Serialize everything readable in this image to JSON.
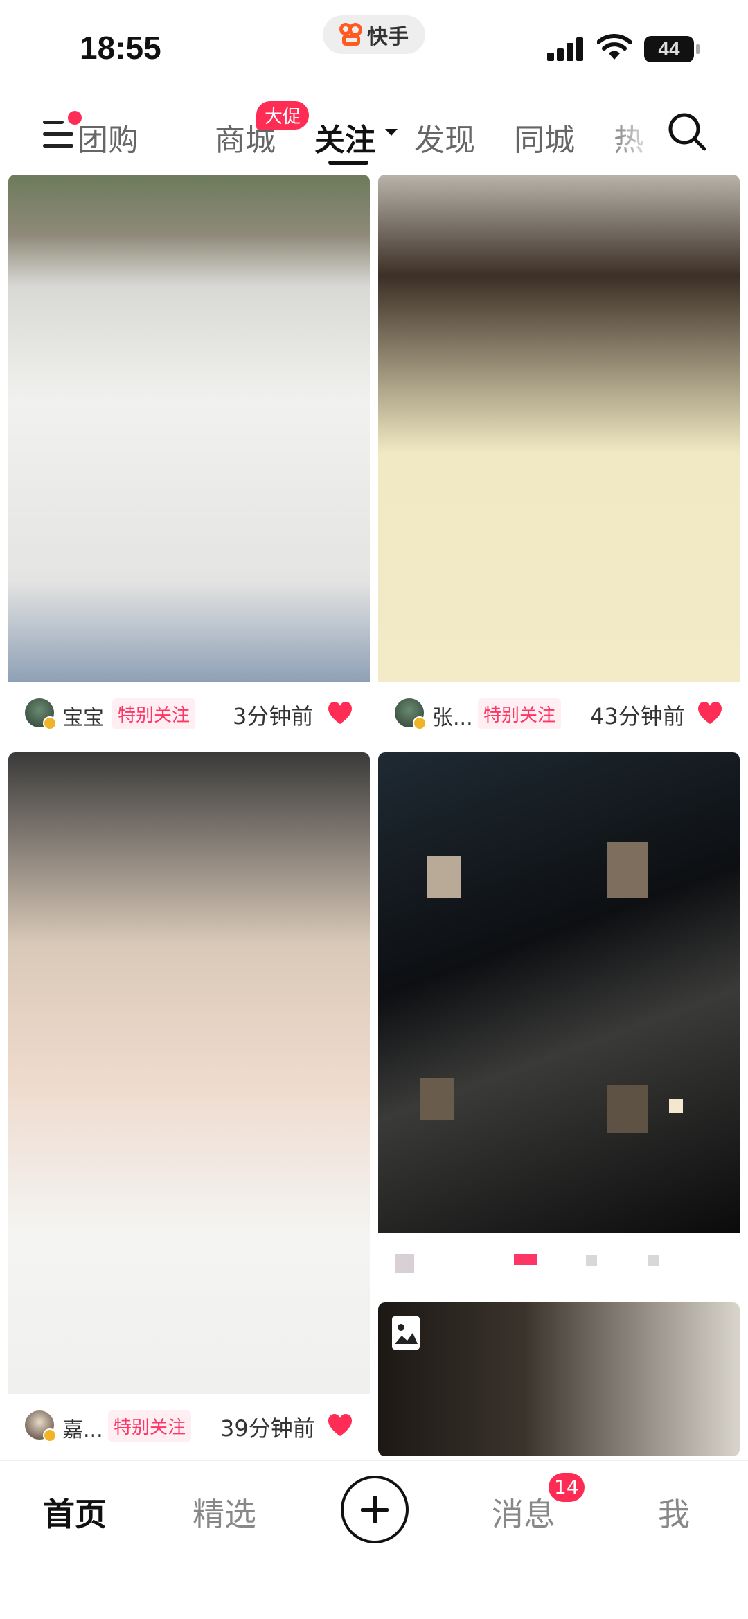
{
  "status_bar": {
    "time": "18:55",
    "app_pill": "快手",
    "battery": "44",
    "icons": [
      "signal-icon",
      "wifi-icon",
      "battery-icon"
    ]
  },
  "top_nav": {
    "tabs": [
      {
        "label": "团购"
      },
      {
        "label": "商城",
        "badge": "大促"
      },
      {
        "label": "关注",
        "active": true
      },
      {
        "label": "发现"
      },
      {
        "label": "同城"
      },
      {
        "label": "热"
      }
    ],
    "icons": [
      "menu-icon",
      "search-icon"
    ]
  },
  "feed": [
    {
      "author": "宝宝",
      "tag": "特别关注",
      "time": "3分钟前"
    },
    {
      "author": "张...",
      "tag": "特别关注",
      "time": "43分钟前"
    },
    {
      "author": "嘉...",
      "tag": "特别关注",
      "time": "39分钟前"
    },
    {
      "author": "",
      "tag": "",
      "time": ""
    }
  ],
  "bottom_tabs": {
    "home": "首页",
    "featured": "精选",
    "messages": "消息",
    "me": "我",
    "messages_badge": "14"
  },
  "colors": {
    "accent": "#fe3666",
    "tag_bg": "#ffeef2",
    "heart": "#ff2d55",
    "text_primary": "#111111"
  }
}
